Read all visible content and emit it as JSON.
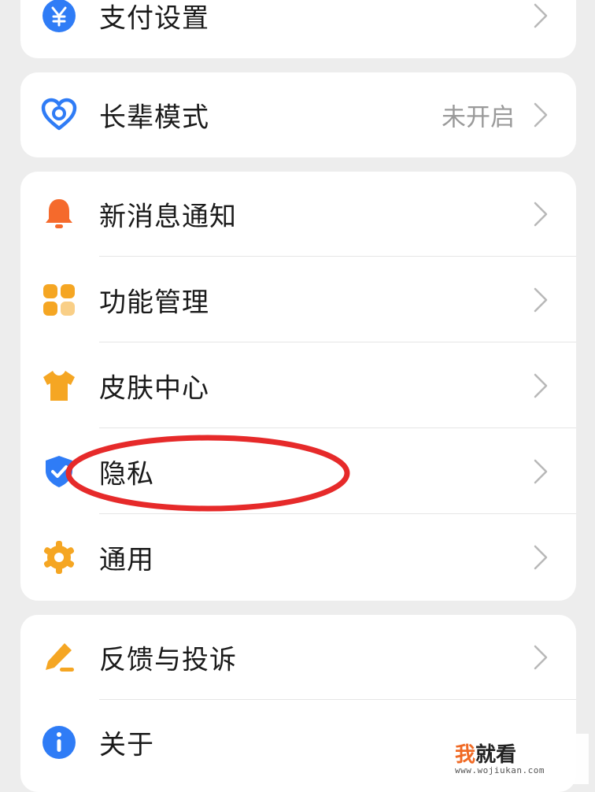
{
  "menu": {
    "payment_settings": {
      "label": "支付设置",
      "icon": "yen-icon"
    },
    "elder_mode": {
      "label": "长辈模式",
      "value": "未开启",
      "icon": "heart-icon"
    },
    "notifications": {
      "label": "新消息通知",
      "icon": "bell-icon"
    },
    "feature_management": {
      "label": "功能管理",
      "icon": "grid-icon"
    },
    "skin_center": {
      "label": "皮肤中心",
      "icon": "tshirt-icon"
    },
    "privacy": {
      "label": "隐私",
      "icon": "shield-icon"
    },
    "general": {
      "label": "通用",
      "icon": "gear-icon"
    },
    "feedback": {
      "label": "反馈与投诉",
      "icon": "edit-icon"
    },
    "about": {
      "label": "关于",
      "icon": "info-icon"
    }
  },
  "watermark": {
    "accent_text": "我",
    "main_text": "就看",
    "url": "www.wojiukan.com"
  },
  "colors": {
    "background": "#ededed",
    "card": "#ffffff",
    "blue": "#2f7cf6",
    "orange": "#f5a623",
    "red_orange": "#f56a2c",
    "annotation_red": "#e62a2a"
  }
}
